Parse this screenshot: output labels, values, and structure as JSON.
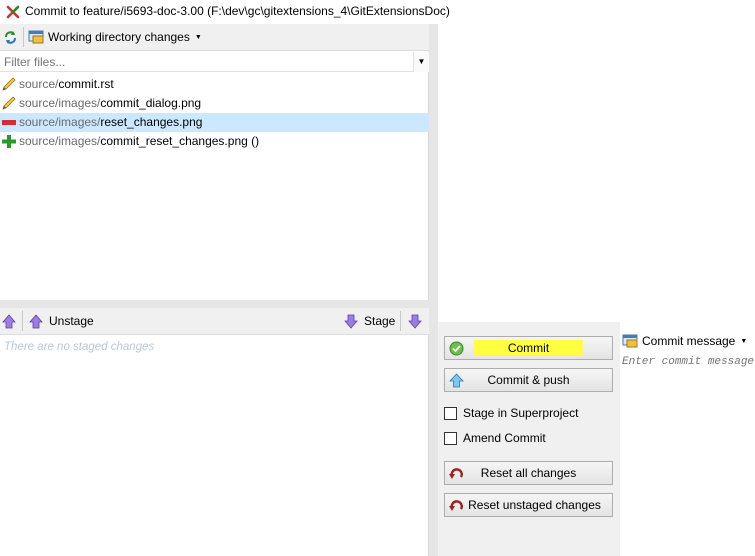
{
  "window": {
    "title": "Commit to feature/i5693-doc-3.00 (F:\\dev\\gc\\gitextensions_4\\GitExtensionsDoc)"
  },
  "unstaged": {
    "dropdown_label": "Working directory changes",
    "filter_placeholder": "Filter files...",
    "files": [
      {
        "dir": "source/",
        "name": "commit.rst",
        "status": "modified",
        "selected": false
      },
      {
        "dir": "source/images/",
        "name": "commit_dialog.png",
        "status": "modified",
        "selected": false
      },
      {
        "dir": "source/images/",
        "name": "reset_changes.png",
        "status": "deleted",
        "selected": true
      },
      {
        "dir": "source/images/",
        "name": "commit_reset_changes.png ()",
        "status": "added",
        "selected": false
      }
    ]
  },
  "staged": {
    "unstage_label": "Unstage",
    "stage_label": "Stage",
    "empty_text": "There are no staged changes"
  },
  "actions": {
    "commit_label": "Commit",
    "commit_push_label": "Commit & push",
    "stage_superproject_label": "Stage in Superproject",
    "amend_label": "Amend Commit",
    "reset_all_label": "Reset all changes",
    "reset_unstaged_label": "Reset unstaged changes"
  },
  "message": {
    "toolbar_label": "Commit message",
    "placeholder": "Enter commit message"
  },
  "colors": {
    "highlight": "#ffff40",
    "selection": "#cce8ff",
    "modified_icon": "#d4a017",
    "deleted_icon": "#cc2222",
    "added_icon": "#22a022"
  }
}
